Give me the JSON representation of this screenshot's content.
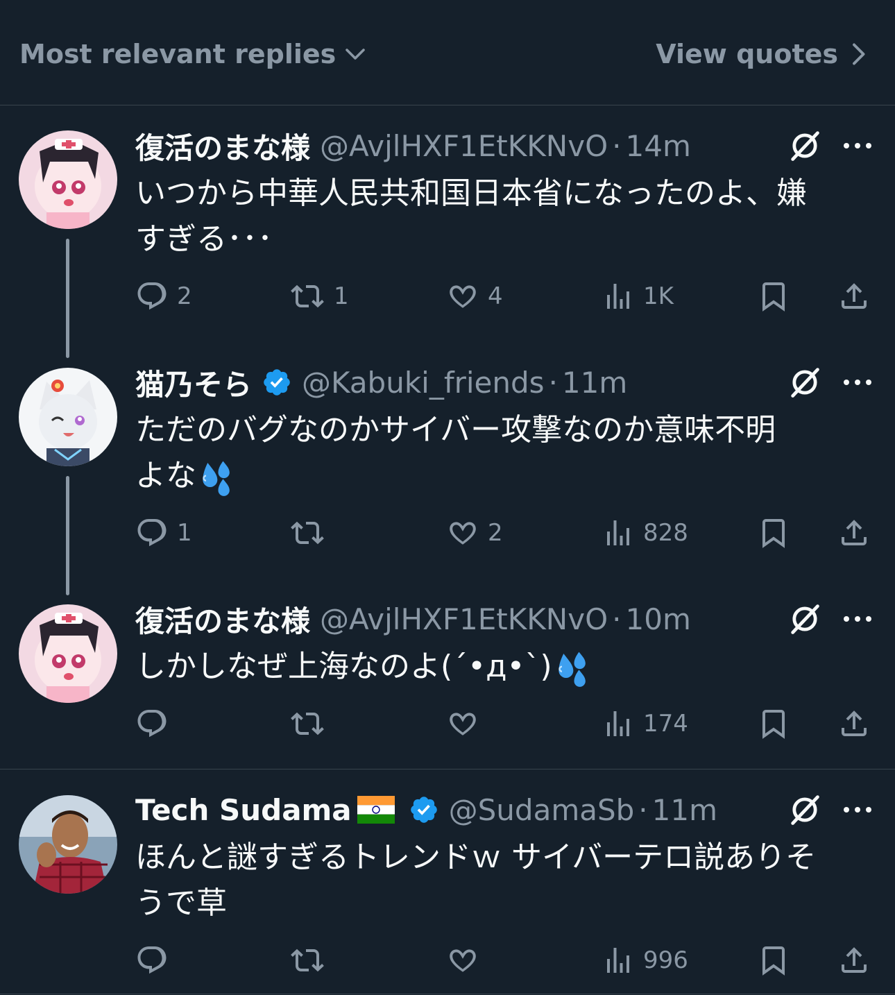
{
  "header": {
    "sort_label": "Most relevant replies",
    "quotes_label": "View quotes"
  },
  "replies": [
    {
      "name": "復活のまな様",
      "handle": "@AvjlHXF1EtKKNvO",
      "separator": "·",
      "time": "14m",
      "verified": false,
      "text_line1": "いつから中華人民共和国日本省になったのよ、嫌",
      "text_line2": "すぎる･･･",
      "stats": {
        "replies": "2",
        "reposts": "1",
        "likes": "4",
        "views": "1K"
      }
    },
    {
      "name": "猫乃そら",
      "handle": "@Kabuki_friends",
      "separator": "·",
      "time": "11m",
      "verified": true,
      "text_line1": "ただのバグなのかサイバー攻撃なのか意味不明",
      "text_line2": "よな",
      "stats": {
        "replies": "1",
        "reposts": "",
        "likes": "2",
        "views": "828"
      }
    },
    {
      "name": "復活のまな様",
      "handle": "@AvjlHXF1EtKKNvO",
      "separator": "·",
      "time": "10m",
      "verified": false,
      "text_line1": "しかしなぜ上海なのよ(´•д•`)",
      "stats": {
        "replies": "",
        "reposts": "",
        "likes": "",
        "views": "174"
      }
    },
    {
      "name": "Tech Sudama",
      "handle": "@SudamaSb",
      "separator": "·",
      "time": "11m",
      "verified": true,
      "text_line1": "ほんと謎すぎるトレンドｗ サイバーテロ説ありそ",
      "text_line2": "うで草",
      "stats": {
        "replies": "",
        "reposts": "",
        "likes": "",
        "views": "996"
      }
    }
  ],
  "colors": {
    "background": "#15202b",
    "text": "#f7f9f9",
    "muted": "#8b98a5",
    "divider": "#38444d",
    "verified": "#1d9bf0"
  }
}
